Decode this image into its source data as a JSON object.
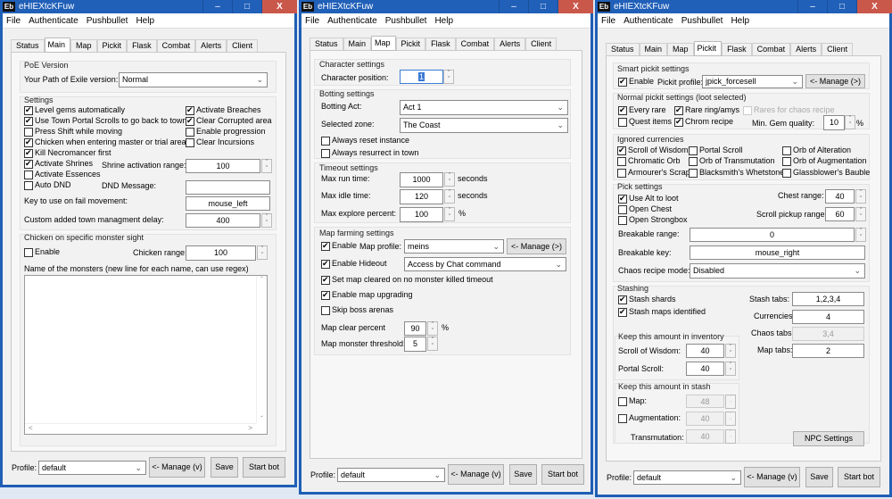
{
  "app": {
    "title": "eHIEXtcKFuw",
    "icon_text": "Eb",
    "menu": [
      "File",
      "Authenticate",
      "Pushbullet",
      "Help"
    ],
    "tabs": [
      "Status",
      "Main",
      "Map",
      "Pickit",
      "Flask",
      "Combat",
      "Alerts",
      "Client"
    ],
    "window_buttons": {
      "minimize": "‒",
      "maximize": "□",
      "close": "X"
    }
  },
  "windows": [
    {
      "selected_tab": "Main"
    },
    {
      "selected_tab": "Map"
    },
    {
      "selected_tab": "Pickit"
    }
  ],
  "footer": {
    "profile_label": "Profile:",
    "profile_value": "default",
    "manage": "<- Manage (v)",
    "save": "Save",
    "start": "Start bot"
  },
  "colors": {
    "titlebar": "#2160b9",
    "close_button": "#c9574a",
    "window_bg": "#f0f0f0"
  },
  "main": {
    "poe_group": "PoE Version",
    "poe_label": "Your Path of Exile version:",
    "poe_value": "Normal",
    "settings_group": "Settings",
    "settings": [
      {
        "label": "Level gems automatically",
        "checked": true
      },
      {
        "label": "Use Town Portal Scrolls to go back to town",
        "checked": true
      },
      {
        "label": "Press Shift while moving",
        "checked": false
      },
      {
        "label": "Chicken when entering master or trial area",
        "checked": true
      },
      {
        "label": "Kill Necromancer first",
        "checked": true
      },
      {
        "label": "Activate Shrines",
        "checked": true
      },
      {
        "label": "Activate Essences",
        "checked": false
      },
      {
        "label": "Auto DND",
        "checked": false
      },
      {
        "label": "Activate Breaches",
        "checked": true
      },
      {
        "label": "Clear Corrupted area",
        "checked": true
      },
      {
        "label": "Enable progression",
        "checked": false
      },
      {
        "label": "Clear Incursions",
        "checked": false
      }
    ],
    "shrine_label": "Shrine activation range:",
    "shrine_value": "100",
    "dnd_label": "DND Message:",
    "dnd_value": "",
    "fail_key_label": "Key to use on fail movement:",
    "fail_key_value": "mouse_left",
    "delay_label": "Custom added town managment delay:",
    "delay_value": "400",
    "chicken_group": "Chicken on specific monster sight",
    "chicken_enable": {
      "label": "Enable",
      "checked": false
    },
    "chicken_range_label": "Chicken range:",
    "chicken_range_value": "100",
    "monsters_label": "Name of the monsters (new line for each name, can use regex)",
    "monsters_value": ""
  },
  "map": {
    "char_group": "Character settings",
    "char_pos_label": "Character position:",
    "char_pos_value": "1",
    "botting_group": "Botting settings",
    "act_label": "Botting Act:",
    "act_value": "Act 1",
    "zone_label": "Selected zone:",
    "zone_value": "The Coast",
    "reset_instance": {
      "label": "Always reset instance",
      "checked": false
    },
    "resurrect_town": {
      "label": "Always resurrect in town",
      "checked": false
    },
    "timeout_group": "Timeout settings",
    "run_label": "Max run time:",
    "run_value": "1000",
    "idle_label": "Max idle time:",
    "idle_value": "120",
    "explore_label": "Max explore percent:",
    "explore_value": "100",
    "seconds": "seconds",
    "percent": "%",
    "farm_group": "Map farming settings",
    "enable": {
      "label": "Enable",
      "checked": true
    },
    "profile_label": "Map profile:",
    "profile_value": "meins",
    "manage": "<- Manage (>)",
    "hideout": {
      "label": "Enable Hideout",
      "checked": true
    },
    "hideout_value": "Access by Chat command",
    "set_cleared": {
      "label": "Set map cleared on no monster killed timeout",
      "checked": true
    },
    "upgrading": {
      "label": "Enable map upgrading",
      "checked": true
    },
    "skip_boss": {
      "label": "Skip boss arenas",
      "checked": false
    },
    "clear_label": "Map clear percent",
    "clear_value": "90",
    "threshold_label": "Map monster threshold:",
    "threshold_value": "5"
  },
  "pickit": {
    "smart_group": "Smart pickit settings",
    "enable": {
      "label": "Enable",
      "checked": true
    },
    "profile_label": "Pickit profile:",
    "profile_value": "jpick_forcesell",
    "manage": "<- Manage (>)",
    "normal_group": "Normal pickit settings (loot selected)",
    "normal": [
      {
        "label": "Every rare",
        "checked": true
      },
      {
        "label": "Rare ring/amys",
        "checked": true
      },
      {
        "label": "Rares for chaos recipe",
        "checked": false
      },
      {
        "label": "Quest items",
        "checked": false
      },
      {
        "label": "Chrom recipe",
        "checked": true
      }
    ],
    "gem_label": "Min. Gem quality:",
    "gem_value": "10",
    "percent": "%",
    "ignored_group": "Ignored currencies",
    "ignored": [
      {
        "label": "Scroll of Wisdom",
        "checked": true
      },
      {
        "label": "Portal Scroll",
        "checked": false
      },
      {
        "label": "Orb of Alteration",
        "checked": false
      },
      {
        "label": "Chromatic Orb",
        "checked": false
      },
      {
        "label": "Orb of Transmutation",
        "checked": false
      },
      {
        "label": "Orb of Augmentation",
        "checked": false
      },
      {
        "label": "Armourer's Scrap",
        "checked": false
      },
      {
        "label": "Blacksmith's Whetstone",
        "checked": false
      },
      {
        "label": "Glassblower's Bauble",
        "checked": false
      }
    ],
    "pick_group": "Pick settings",
    "alt_loot": {
      "label": "Use Alt to loot",
      "checked": true
    },
    "open_chest": {
      "label": "Open Chest",
      "checked": false
    },
    "open_strongbox": {
      "label": "Open Strongbox",
      "checked": false
    },
    "chest_label": "Chest range:",
    "chest_value": "40",
    "scroll_label": "Scroll pickup range:",
    "scroll_value": "60",
    "breakable_range_label": "Breakable range:",
    "breakable_range_value": "0",
    "breakable_key_label": "Breakable key:",
    "breakable_key_value": "mouse_right",
    "chaos_mode_label": "Chaos recipe mode:",
    "chaos_mode_value": "Disabled",
    "stash_group": "Stashing",
    "stash_shards": {
      "label": "Stash shards",
      "checked": true
    },
    "stash_maps": {
      "label": "Stash maps identified",
      "checked": true
    },
    "stash_tabs_label": "Stash tabs:",
    "stash_tabs_value": "1,2,3,4",
    "currencies_label": "Currencies:",
    "currencies_value": "4",
    "chaos_tabs_label": "Chaos tabs:",
    "chaos_tabs_value": "3,4",
    "map_tabs_label": "Map tabs:",
    "map_tabs_value": "2",
    "inv_group": "Keep this amount in inventory",
    "wisdom_label": "Scroll of Wisdom:",
    "wisdom_value": "40",
    "portal_label": "Portal Scroll:",
    "portal_value": "40",
    "keep_stash_group": "Keep this amount in stash",
    "keep_map": {
      "label": "Map:",
      "checked": false
    },
    "keep_map_value": "48",
    "keep_aug": {
      "label": "Augmentation:",
      "checked": false
    },
    "keep_aug_value": "40",
    "transmutation_label": "Transmutation:",
    "transmutation_value": "40",
    "npc_settings": "NPC Settings"
  }
}
